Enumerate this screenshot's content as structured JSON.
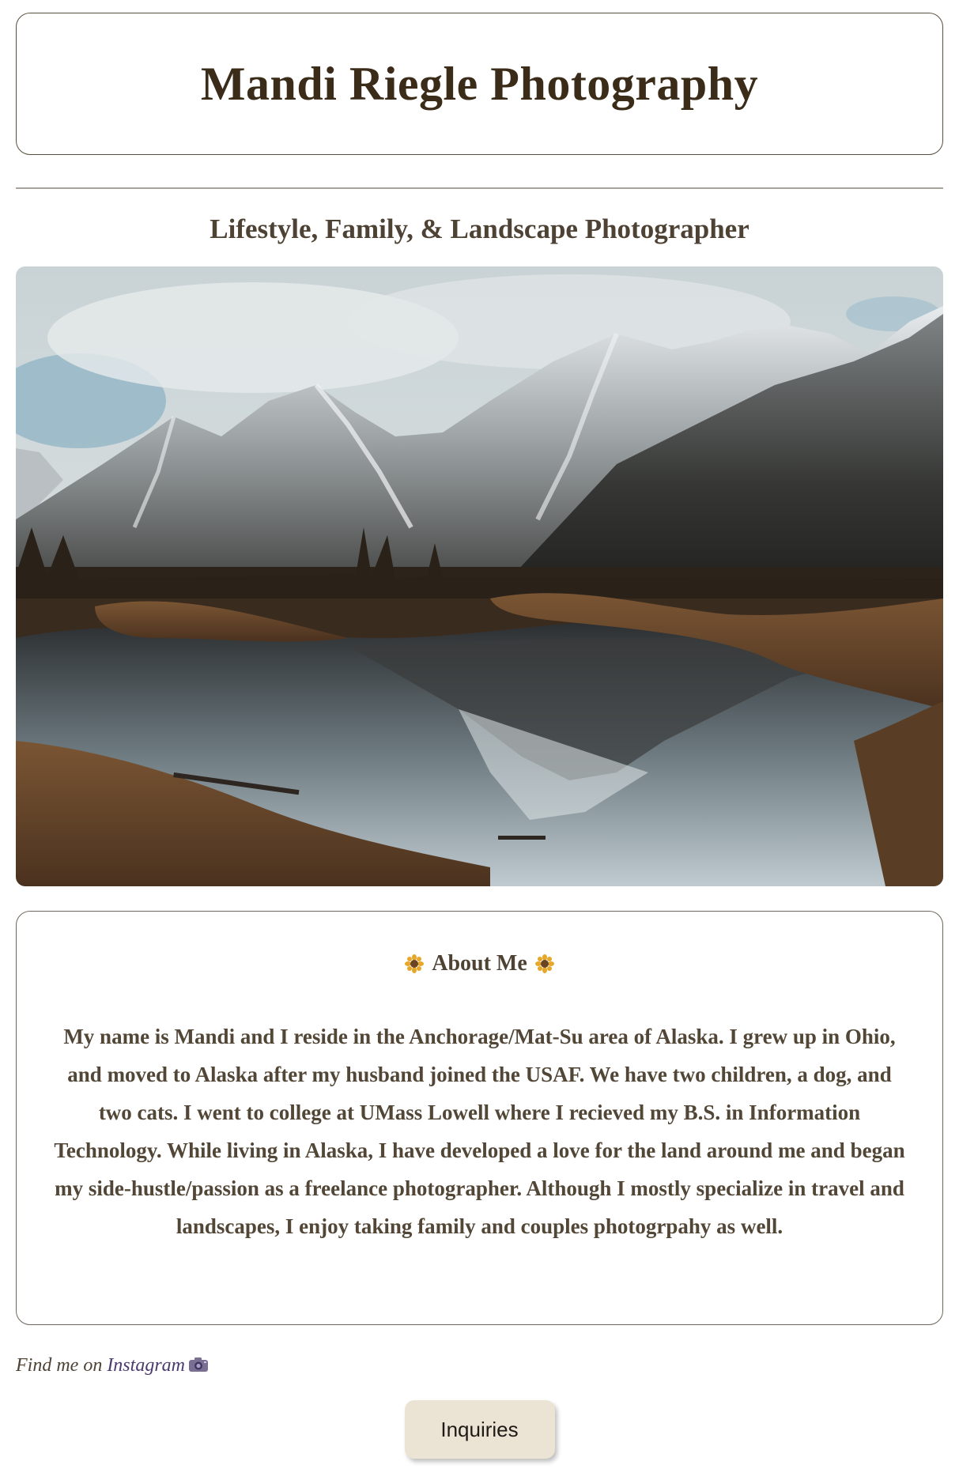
{
  "header": {
    "title": "Mandi Riegle Photography"
  },
  "subtitle": "Lifestyle, Family, & Landscape Photographer",
  "hero": {
    "icon": "landscape-photo"
  },
  "about": {
    "heading": "About Me",
    "heading_icon": "sunflower-icon",
    "body": "My name is Mandi and I reside in the Anchorage/Mat-Su area of Alaska. I grew up in Ohio, and moved to Alaska after my husband joined the USAF. We have two children, a dog, and two cats. I went to college at UMass Lowell where I recieved my B.S. in Information Technology. While living in Alaska, I have developed a love for the land around me and began my side-hustle/passion as a freelance photographer. Although I mostly specialize in travel and landscapes, I enjoy taking family and couples photogrpahy as well."
  },
  "social": {
    "prefix": "Find me on ",
    "link_label": "Instagram",
    "icon": "camera-icon"
  },
  "cta": {
    "label": "Inquiries"
  },
  "colors": {
    "title": "#3a2c19",
    "text": "#524636",
    "button_bg": "#ebe4d4",
    "link": "#4b3a6e"
  }
}
